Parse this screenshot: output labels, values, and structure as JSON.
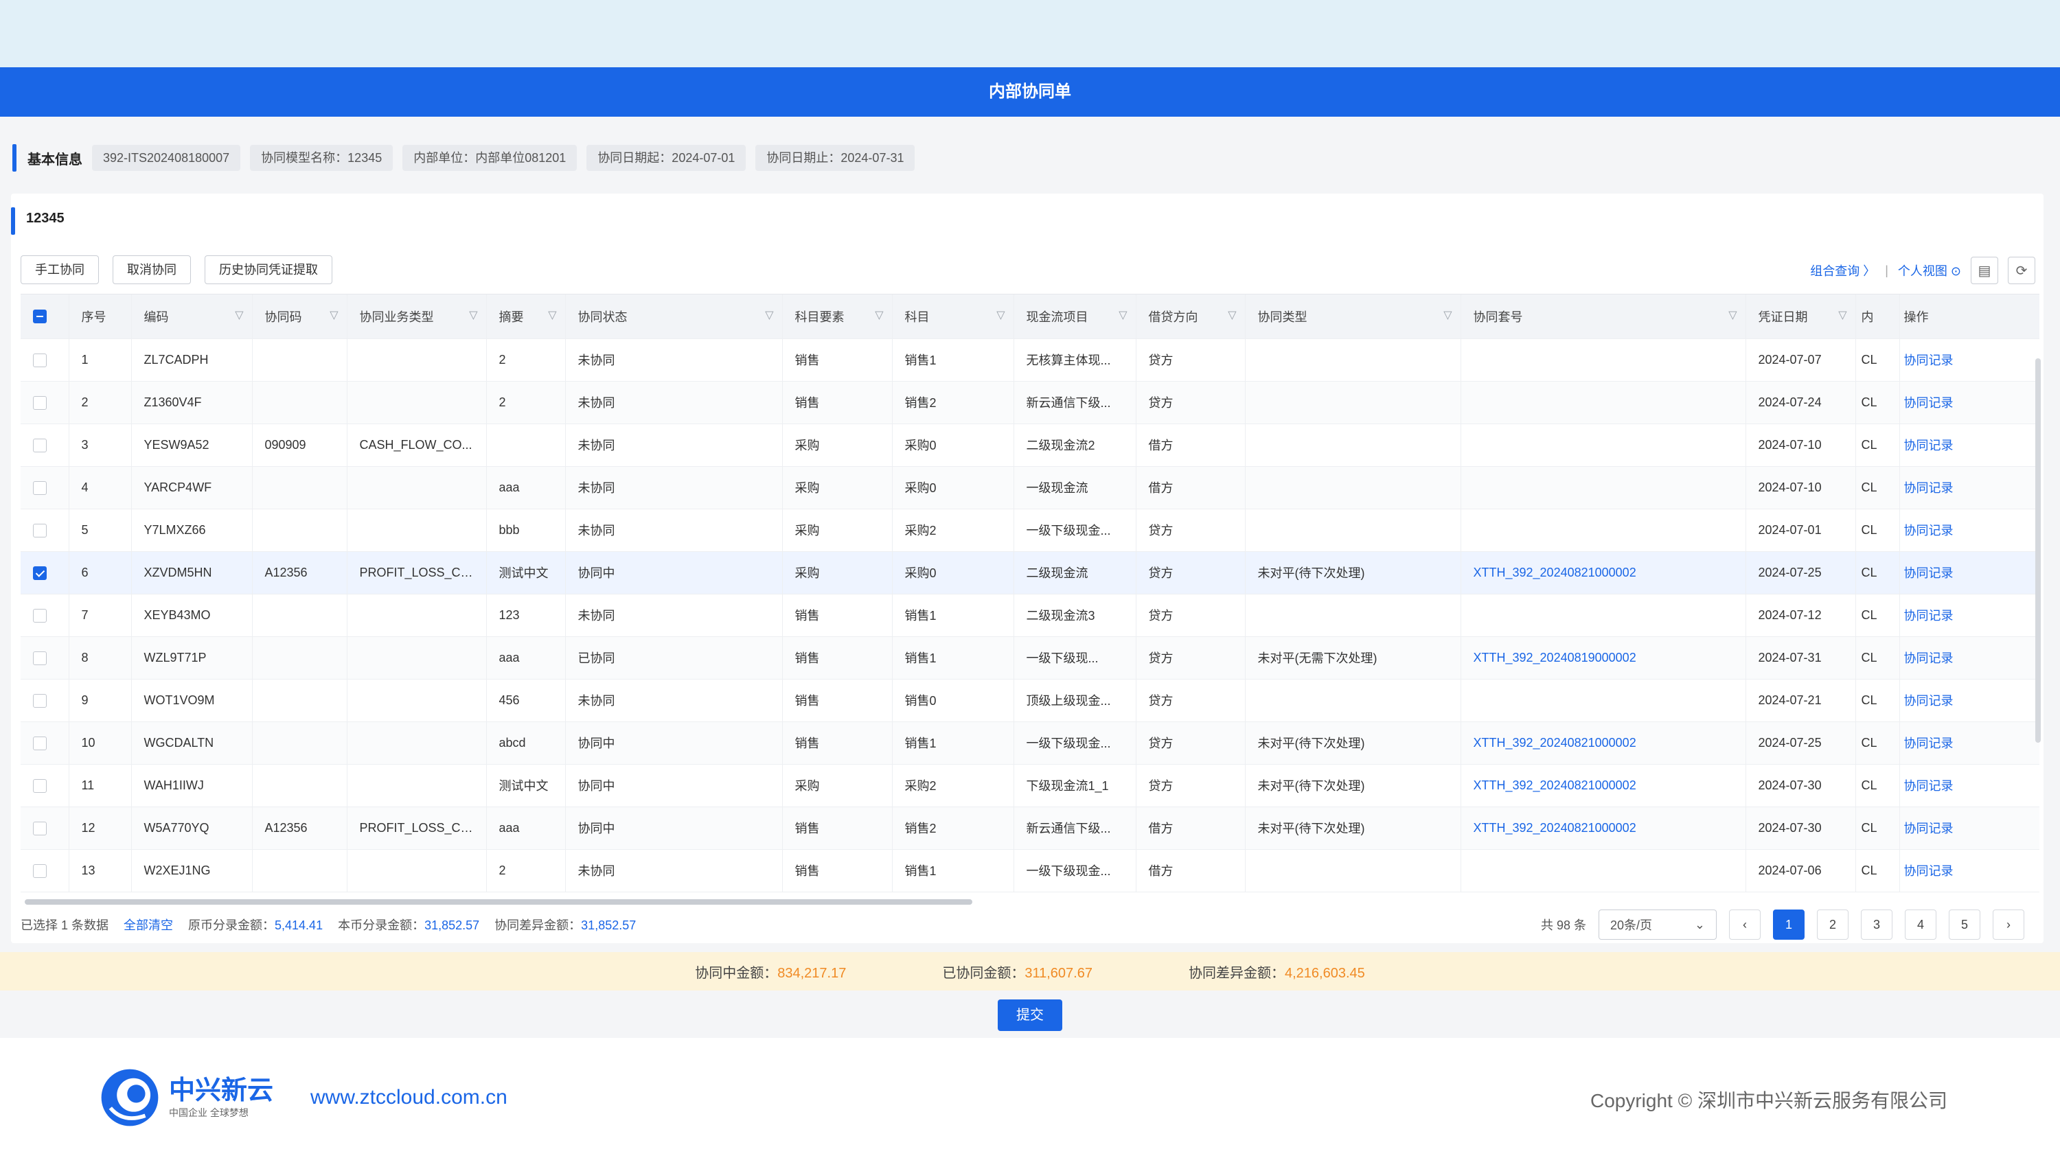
{
  "window": {
    "title": "内部协同单"
  },
  "basic_info": {
    "label": "基本信息",
    "tags": [
      "392-ITS202408180007",
      "协同模型名称：12345",
      "内部单位：内部单位081201",
      "协同日期起：2024-07-01",
      "协同日期止：2024-07-31"
    ]
  },
  "panel": {
    "title": "12345"
  },
  "toolbar": {
    "manual": "手工协同",
    "cancel": "取消协同",
    "history": "历史协同凭证提取"
  },
  "right_tools": {
    "combo_query": "组合查询 〉",
    "separator": "|",
    "personal_view": "个人视图 ⊙"
  },
  "table": {
    "columns": [
      "序号",
      "编码",
      "协同码",
      "协同业务类型",
      "摘要",
      "协同状态",
      "科目要素",
      "科目",
      "现金流项目",
      "借贷方向",
      "协同类型",
      "协同套号",
      "凭证日期",
      "内",
      "操作"
    ],
    "rows": [
      {
        "no": "1",
        "code": "ZL7CADPH",
        "sync_code": "",
        "biz_type": "",
        "summary": "2",
        "status": "未协同",
        "elem": "销售",
        "subject": "销售1",
        "cashflow": "无核算主体现...",
        "dir": "贷方",
        "sync_type": "",
        "set_no": "",
        "date": "2024-07-07",
        "inner": "CL",
        "op": "协同记录",
        "checked": false
      },
      {
        "no": "2",
        "code": "Z1360V4F",
        "sync_code": "",
        "biz_type": "",
        "summary": "2",
        "status": "未协同",
        "elem": "销售",
        "subject": "销售2",
        "cashflow": "新云通信下级...",
        "dir": "贷方",
        "sync_type": "",
        "set_no": "",
        "date": "2024-07-24",
        "inner": "CL",
        "op": "协同记录",
        "checked": false
      },
      {
        "no": "3",
        "code": "YESW9A52",
        "sync_code": "090909",
        "biz_type": "CASH_FLOW_CO...",
        "summary": "",
        "status": "未协同",
        "elem": "采购",
        "subject": "采购0",
        "cashflow": "二级现金流2",
        "dir": "借方",
        "sync_type": "",
        "set_no": "",
        "date": "2024-07-10",
        "inner": "CL",
        "op": "协同记录",
        "checked": false
      },
      {
        "no": "4",
        "code": "YARCP4WF",
        "sync_code": "",
        "biz_type": "",
        "summary": "aaa",
        "status": "未协同",
        "elem": "采购",
        "subject": "采购0",
        "cashflow": "一级现金流",
        "dir": "借方",
        "sync_type": "",
        "set_no": "",
        "date": "2024-07-10",
        "inner": "CL",
        "op": "协同记录",
        "checked": false
      },
      {
        "no": "5",
        "code": "Y7LMXZ66",
        "sync_code": "",
        "biz_type": "",
        "summary": "bbb",
        "status": "未协同",
        "elem": "采购",
        "subject": "采购2",
        "cashflow": "一级下级现金...",
        "dir": "贷方",
        "sync_type": "",
        "set_no": "",
        "date": "2024-07-01",
        "inner": "CL",
        "op": "协同记录",
        "checked": false
      },
      {
        "no": "6",
        "code": "XZVDM5HN",
        "sync_code": "A12356",
        "biz_type": "PROFIT_LOSS_CO...",
        "summary": "测试中文",
        "status": "协同中",
        "elem": "采购",
        "subject": "采购0",
        "cashflow": "二级现金流",
        "dir": "贷方",
        "sync_type": "未对平(待下次处理)",
        "set_no": "XTTH_392_20240821000002",
        "date": "2024-07-25",
        "inner": "CL",
        "op": "协同记录",
        "checked": true
      },
      {
        "no": "7",
        "code": "XEYB43MO",
        "sync_code": "",
        "biz_type": "",
        "summary": "123",
        "status": "未协同",
        "elem": "销售",
        "subject": "销售1",
        "cashflow": "二级现金流3",
        "dir": "贷方",
        "sync_type": "",
        "set_no": "",
        "date": "2024-07-12",
        "inner": "CL",
        "op": "协同记录",
        "checked": false
      },
      {
        "no": "8",
        "code": "WZL9T71P",
        "sync_code": "",
        "biz_type": "",
        "summary": "aaa",
        "status": "已协同",
        "elem": "销售",
        "subject": "销售1",
        "cashflow": "一级下级现...",
        "dir": "贷方",
        "sync_type": "未对平(无需下次处理)",
        "set_no": "XTTH_392_20240819000002",
        "date": "2024-07-31",
        "inner": "CL",
        "op": "协同记录",
        "checked": false
      },
      {
        "no": "9",
        "code": "WOT1VO9M",
        "sync_code": "",
        "biz_type": "",
        "summary": "456",
        "status": "未协同",
        "elem": "销售",
        "subject": "销售0",
        "cashflow": "顶级上级现金...",
        "dir": "贷方",
        "sync_type": "",
        "set_no": "",
        "date": "2024-07-21",
        "inner": "CL",
        "op": "协同记录",
        "checked": false
      },
      {
        "no": "10",
        "code": "WGCDALTN",
        "sync_code": "",
        "biz_type": "",
        "summary": "abcd",
        "status": "协同中",
        "elem": "销售",
        "subject": "销售1",
        "cashflow": "一级下级现金...",
        "dir": "贷方",
        "sync_type": "未对平(待下次处理)",
        "set_no": "XTTH_392_20240821000002",
        "date": "2024-07-25",
        "inner": "CL",
        "op": "协同记录",
        "checked": false
      },
      {
        "no": "11",
        "code": "WAH1IIWJ",
        "sync_code": "",
        "biz_type": "",
        "summary": "测试中文",
        "status": "协同中",
        "elem": "采购",
        "subject": "采购2",
        "cashflow": "下级现金流1_1",
        "dir": "贷方",
        "sync_type": "未对平(待下次处理)",
        "set_no": "XTTH_392_20240821000002",
        "date": "2024-07-30",
        "inner": "CL",
        "op": "协同记录",
        "checked": false
      },
      {
        "no": "12",
        "code": "W5A770YQ",
        "sync_code": "A12356",
        "biz_type": "PROFIT_LOSS_CO...",
        "summary": "aaa",
        "status": "协同中",
        "elem": "销售",
        "subject": "销售2",
        "cashflow": "新云通信下级...",
        "dir": "借方",
        "sync_type": "未对平(待下次处理)",
        "set_no": "XTTH_392_20240821000002",
        "date": "2024-07-30",
        "inner": "CL",
        "op": "协同记录",
        "checked": false
      },
      {
        "no": "13",
        "code": "W2XEJ1NG",
        "sync_code": "",
        "biz_type": "",
        "summary": "2",
        "status": "未协同",
        "elem": "销售",
        "subject": "销售1",
        "cashflow": "一级下级现金...",
        "dir": "借方",
        "sync_type": "",
        "set_no": "",
        "date": "2024-07-06",
        "inner": "CL",
        "op": "协同记录",
        "checked": false
      }
    ]
  },
  "summary": {
    "selected": "已选择 1 条数据",
    "clear_all": "全部清空",
    "orig_label": "原币分录金额：",
    "orig_value": "5,414.41",
    "local_label": "本币分录金额：",
    "local_value": "31,852.57",
    "diff_label": "协同差异金额：",
    "diff_value": "31,852.57"
  },
  "pager": {
    "total": "共 98 条",
    "page_size": "20条/页",
    "prev": "‹",
    "next": "›",
    "pages": [
      "1",
      "2",
      "3",
      "4",
      "5"
    ],
    "current": "1"
  },
  "totals": {
    "in_progress_label": "协同中金额：",
    "in_progress_value": "834,217.17",
    "done_label": "已协同金额：",
    "done_value": "311,607.67",
    "diff_label": "协同差异金额：",
    "diff_value": "4,216,603.45"
  },
  "submit": "提交",
  "footer": {
    "logo_name": "中兴新云",
    "logo_slogan": "中国企业 全球梦想",
    "url": "www.ztccloud.com.cn",
    "copyright": "Copyright © 深圳市中兴新云服务有限公司"
  },
  "colors": {
    "primary": "#1a66e6",
    "amount": "#f08a24",
    "totals_bg": "#fdf3d9"
  },
  "icons": [
    "filter-icon",
    "settings-icon",
    "refresh-icon",
    "chevron-down-icon",
    "checkbox-icon",
    "logo-icon"
  ]
}
